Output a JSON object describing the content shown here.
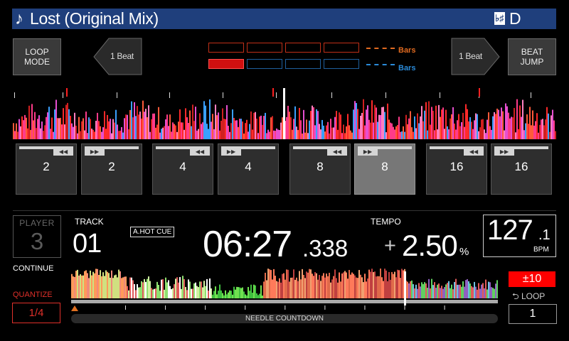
{
  "track": {
    "title": "Lost (Original Mix)",
    "note_icon": "music-note-icon",
    "key_icon": "key-icon",
    "key": "D"
  },
  "buttons": {
    "loop_mode": "LOOP MODE",
    "beat_jump": "BEAT JUMP",
    "beat_left": "1 Beat",
    "beat_right": "1 Beat"
  },
  "bars": {
    "top_label": "Bars",
    "bottom_label": "Bars"
  },
  "pads": [
    {
      "value": "2",
      "direction": "back"
    },
    {
      "value": "2",
      "direction": "forward"
    },
    {
      "value": "4",
      "direction": "back"
    },
    {
      "value": "4",
      "direction": "forward"
    },
    {
      "value": "8",
      "direction": "back"
    },
    {
      "value": "8",
      "direction": "forward",
      "selected": true
    },
    {
      "value": "16",
      "direction": "back"
    },
    {
      "value": "16",
      "direction": "forward"
    }
  ],
  "player": {
    "label": "PLAYER",
    "number": "3"
  },
  "continue_label": "CONTINUE",
  "quantize": {
    "label": "QUANTIZE",
    "value": "1/4"
  },
  "track_info": {
    "label": "TRACK",
    "number": "01",
    "hotcue": "A.HOT CUE"
  },
  "time": {
    "main": "06:27",
    "ms": ".338"
  },
  "tempo": {
    "label": "TEMPO",
    "sign": "+",
    "value": "2.50",
    "unit": "%"
  },
  "bpm": {
    "integer": "127",
    "decimal": ".1",
    "unit": "BPM"
  },
  "tempo_range": "±10",
  "loop": {
    "label": "LOOP",
    "value": "1"
  },
  "needle_countdown": "NEEDLE COUNTDOWN",
  "playback_progress": 0.79,
  "colors": {
    "title_bar": "#1f3f7c",
    "quantize": "#e0302a",
    "range": "#ff0000",
    "bars_orange": "#e06a20",
    "bars_blue": "#2a8ad8"
  }
}
